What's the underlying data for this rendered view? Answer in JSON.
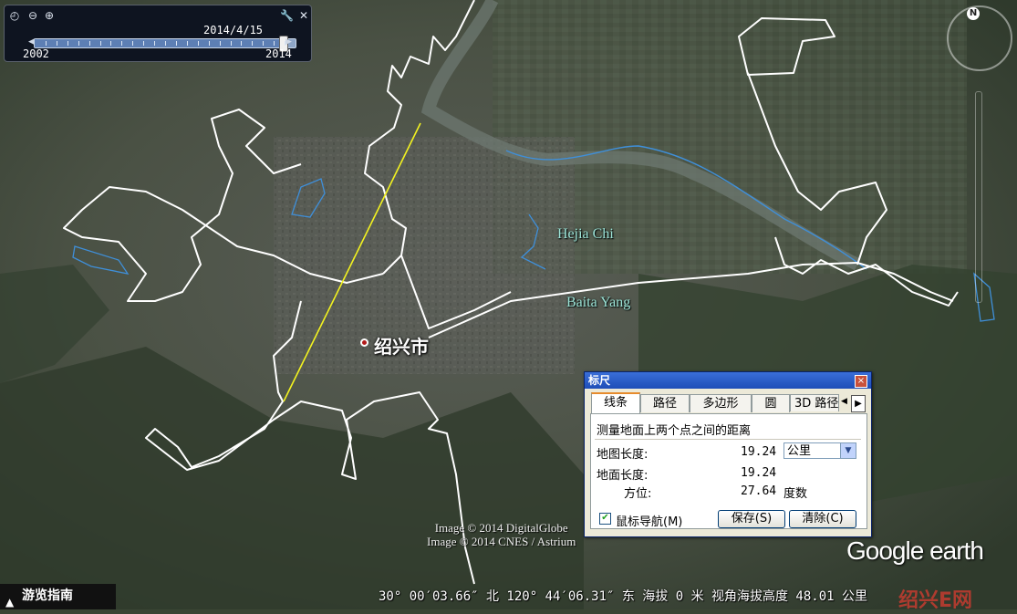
{
  "time_slider": {
    "current_date": "2014/4/15",
    "start_year": "2002",
    "end_year": "2014",
    "position_fraction": 0.95
  },
  "map": {
    "places": [
      {
        "name": "Hejia Chi"
      },
      {
        "name": "Baita Yang"
      }
    ],
    "city": "绍兴市",
    "credit_line1": "Image © 2014 DigitalGlobe",
    "credit_line2": "Image © 2014 CNES / Astrium",
    "logo": "Google earth",
    "watermark": "绍兴E网",
    "compass_letter": "N"
  },
  "ruler": {
    "title": "标尺",
    "close_label": "×",
    "tabs": [
      "线条",
      "路径",
      "多边形",
      "圆",
      "3D 路径"
    ],
    "active_tab": 0,
    "description": "测量地面上两个点之间的距离",
    "map_length_label": "地图长度:",
    "map_length_value": "19.24",
    "unit_selected": "公里",
    "ground_length_label": "地面长度:",
    "ground_length_value": "19.24",
    "heading_label": "方位:",
    "heading_value": "27.64",
    "heading_unit": "度数",
    "mouse_nav_label": "鼠标导航(M)",
    "mouse_nav_checked": true,
    "save_label": "保存(S)",
    "clear_label": "清除(C)"
  },
  "tour_guide_label": "游览指南",
  "status_bar": {
    "text": "30° 00′03.66″ 北 120° 44′06.31″ 东 海拔       0 米  视角海拔高度  48.01 公里"
  },
  "colors": {
    "boundary": "#ffffff",
    "ruler_line": "#f3f320",
    "river": "#3f8fd9",
    "label": "#9de3d6"
  }
}
